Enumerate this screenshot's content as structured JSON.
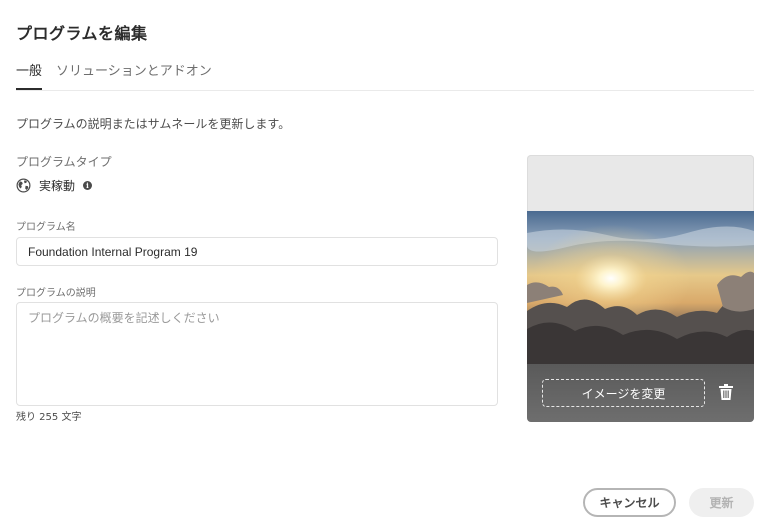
{
  "dialog": {
    "title": "プログラムを編集"
  },
  "tabs": [
    {
      "label": "一般",
      "active": true
    },
    {
      "label": "ソリューションとアドオン",
      "active": false
    }
  ],
  "intro_text": "プログラムの説明またはサムネールを更新します。",
  "program_type": {
    "label": "プログラムタイプ",
    "value": "実稼動",
    "icon": "globe-icon",
    "info_icon": "info-icon"
  },
  "program_name": {
    "label": "プログラム名",
    "value": "Foundation Internal Program 19"
  },
  "program_description": {
    "label": "プログラムの説明",
    "placeholder": "プログラムの概要を記述しください",
    "value": "",
    "remaining": "残り 255 文字"
  },
  "thumbnail": {
    "change_label": "イメージを変更",
    "delete_icon": "trash-icon"
  },
  "footer": {
    "cancel_label": "キャンセル",
    "update_label": "更新"
  },
  "colors": {
    "text_primary": "#2c2c2c",
    "text_secondary": "#6e6e6e",
    "border": "#e1e1e1",
    "disabled_bg": "#efefef",
    "disabled_text": "#b3b3b3"
  }
}
